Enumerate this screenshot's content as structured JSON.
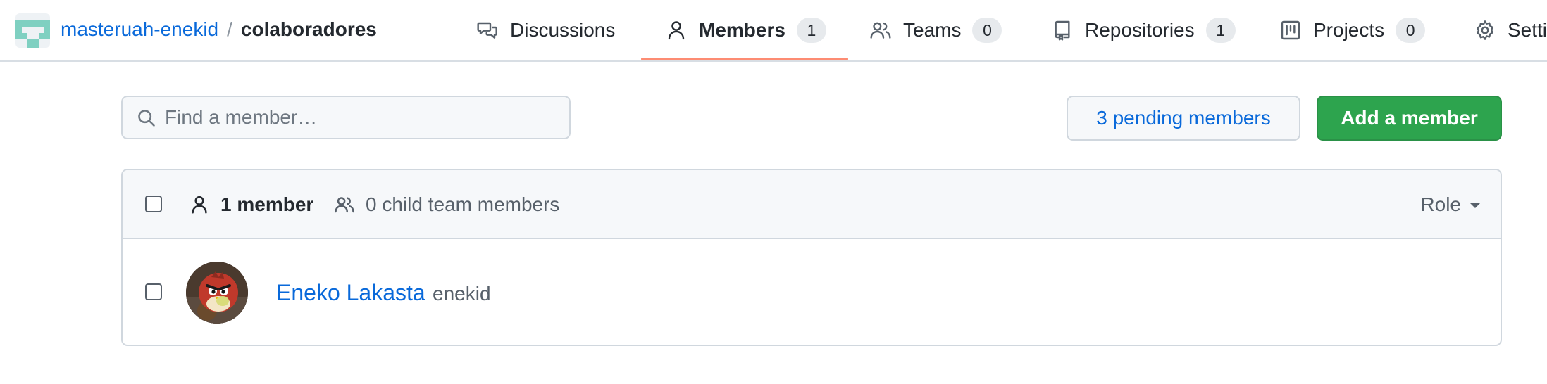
{
  "breadcrumb": {
    "org": "masteruah-enekid",
    "separator": "/",
    "team": "colaboradores"
  },
  "tabs": [
    {
      "label": "Discussions",
      "icon": "discussions-icon",
      "active": false
    },
    {
      "label": "Members",
      "count": "1",
      "icon": "person-icon",
      "active": true
    },
    {
      "label": "Teams",
      "count": "0",
      "icon": "people-icon",
      "active": false
    },
    {
      "label": "Repositories",
      "count": "1",
      "icon": "repo-icon",
      "active": false
    },
    {
      "label": "Projects",
      "count": "0",
      "icon": "project-icon",
      "active": false
    },
    {
      "label": "Settings",
      "icon": "gear-icon",
      "active": false
    }
  ],
  "search": {
    "placeholder": "Find a member…",
    "value": ""
  },
  "actions": {
    "pending_label": "3 pending members",
    "add_label": "Add a member"
  },
  "list_header": {
    "member_count": "1 member",
    "child_team_members": "0 child team members",
    "role_label": "Role"
  },
  "members": [
    {
      "name": "Eneko Lakasta",
      "login": "enekid",
      "avatar": "angry-bird-avatar"
    }
  ],
  "colors": {
    "link": "#0969da",
    "primary_button": "#2da44e",
    "active_tab_underline": "#fd8c73",
    "logo": "#7fd0c1"
  }
}
